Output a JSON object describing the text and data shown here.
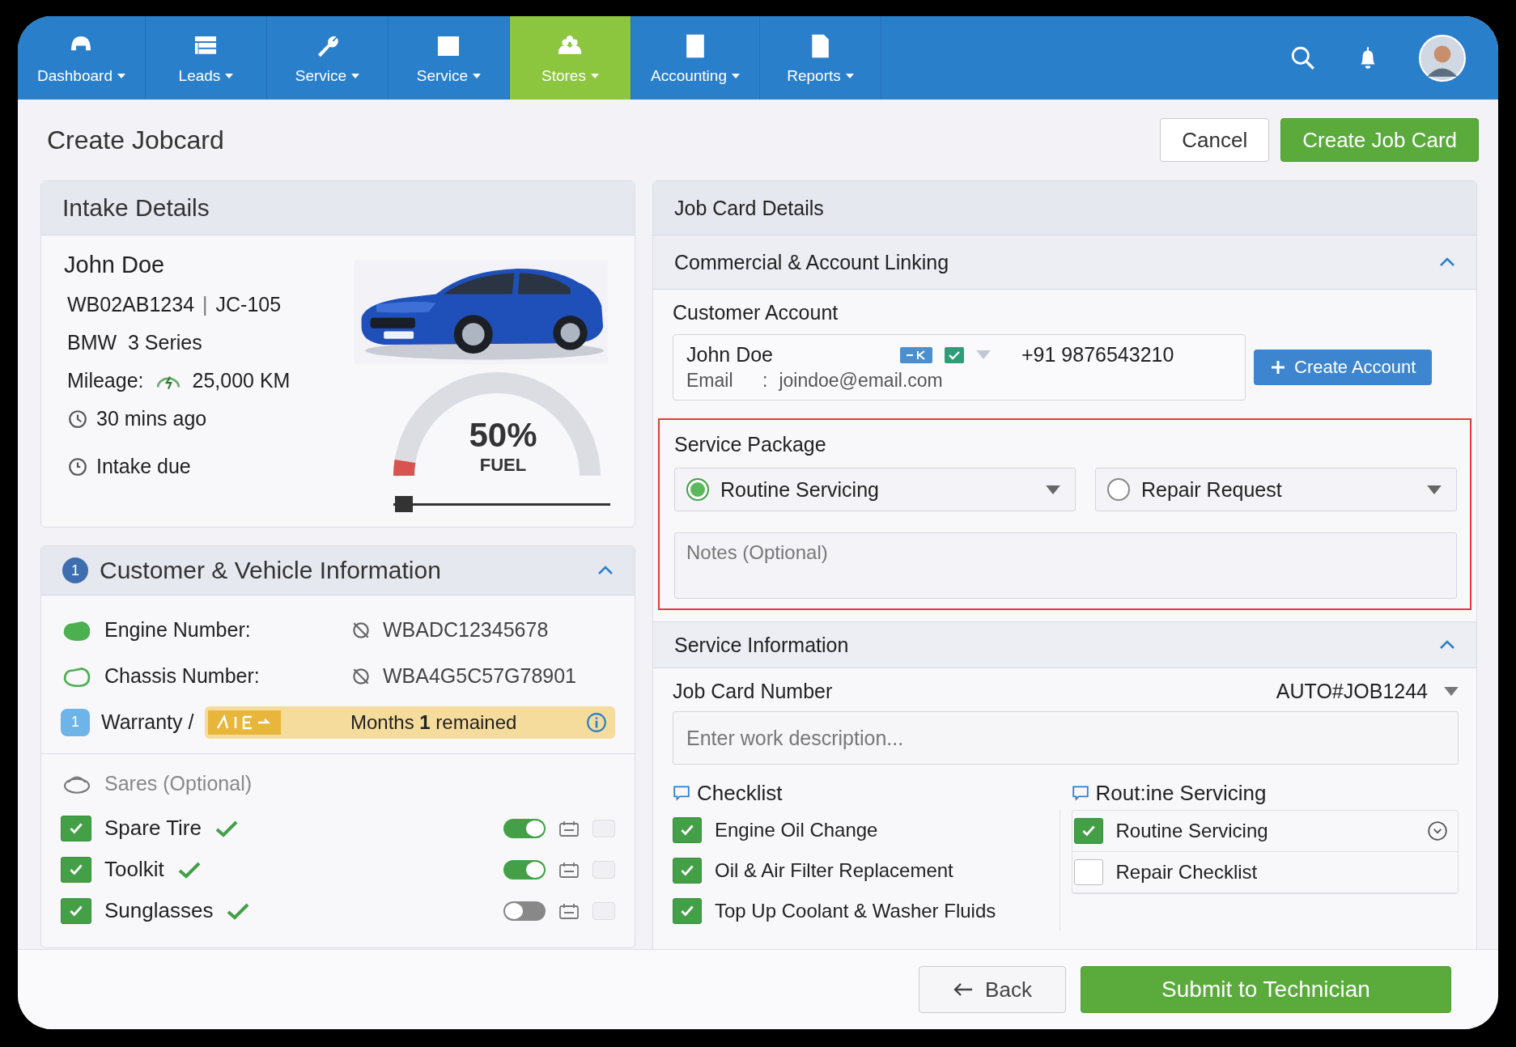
{
  "nav": {
    "items": [
      {
        "label": "Dashboard",
        "selected": false
      },
      {
        "label": "Leads",
        "selected": false
      },
      {
        "label": "Service",
        "selected": false
      },
      {
        "label": "Service",
        "selected": false
      },
      {
        "label": "Stores",
        "selected": true
      },
      {
        "label": "Accounting",
        "selected": false
      },
      {
        "label": "Reports",
        "selected": false
      }
    ]
  },
  "header": {
    "title": "Create Jobcard",
    "buttons": [
      {
        "label": "Cancel",
        "kind": "secondary"
      },
      {
        "label": "Create Job Card",
        "kind": "primary"
      }
    ]
  },
  "intake": {
    "title": "Intake Details",
    "name": "John Doe",
    "plate": "WB02AB1234",
    "separator": "|",
    "job_id": "JC-105",
    "model": "BMW  3 Series",
    "mileage_label": "Mileage:",
    "mileage": "25,000 KM",
    "time_ago": "30 mins ago",
    "due": "Intake due",
    "fuel": {
      "reading": "50%",
      "label": "FUEL",
      "level": 0.05
    }
  },
  "customer_vehicle": {
    "step": "1",
    "title": "Customer & Vehicle Information",
    "expanded": true,
    "fields": [
      {
        "label": "Engine Number:",
        "value": "WBADC12345678"
      },
      {
        "label": "Chassis Number:",
        "value": "WBA4G5C57G78901"
      }
    ],
    "warranty": {
      "step": "1",
      "label": "Warranty /",
      "text": "Months **1** remained"
    },
    "spares": {
      "title": "Sares (Optional)",
      "items": [
        {
          "label": "Spare Tire",
          "checked": true,
          "on": true
        },
        {
          "label": "Toolkit",
          "checked": true,
          "on": true
        },
        {
          "label": "Sunglasses",
          "checked": true,
          "on": false
        }
      ]
    }
  },
  "job_card": {
    "title": "Job Card Details",
    "commercial": {
      "title": "Commercial & Account Linking",
      "expanded": true,
      "account_label": "Customer Account",
      "customer": {
        "name": "John Doe",
        "phone": "+91 9876543210",
        "email_label": "Email",
        "email_separator": ":",
        "email": "joindoe@email.com"
      },
      "create_button": "Create Account"
    },
    "service_package": {
      "title": "Service Package",
      "highlighted": true,
      "options": [
        {
          "label": "Routine Servicing",
          "selected": true
        },
        {
          "label": "Repair Request",
          "selected": false
        }
      ],
      "notes_placeholder": "Notes (Optional)"
    },
    "service_info": {
      "title": "Service Information",
      "expanded": true,
      "job_number_label": "Job Card Number",
      "job_number": "AUTO#JOB1244",
      "description_placeholder": "Enter work description...",
      "checklist": {
        "title": "Checklist",
        "items": [
          {
            "label": "Engine Oil Change",
            "checked": true
          },
          {
            "label": "Oil & Air Filter Replacement",
            "checked": true
          },
          {
            "label": "Top Up Coolant & Washer Fluids",
            "checked": true
          }
        ]
      },
      "routine": {
        "title": "Rout:ine Servicing",
        "items": [
          {
            "label": "Routine Servicing",
            "checked": true
          },
          {
            "label": "Repair Checklist",
            "checked": false
          }
        ]
      }
    }
  },
  "footer": {
    "back": "Back",
    "submit": "Submit to Technician"
  }
}
